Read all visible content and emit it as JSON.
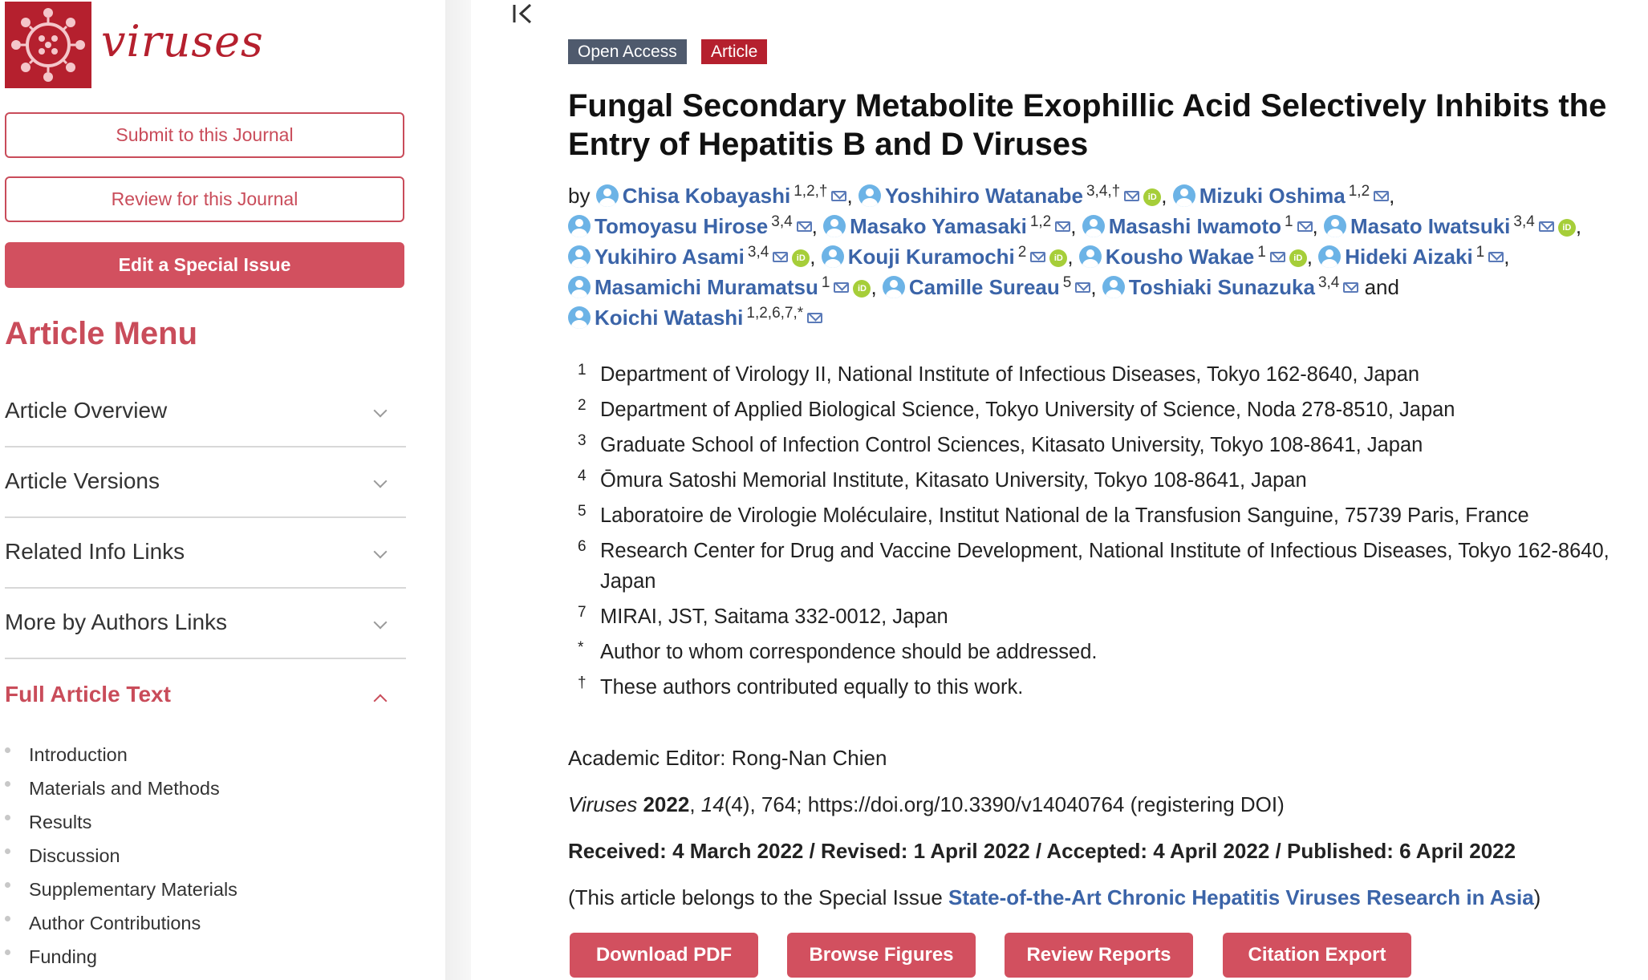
{
  "journal": {
    "name": "viruses",
    "submit_label": "Submit to this Journal",
    "review_label": "Review for this Journal",
    "special_issue_label": "Edit a Special Issue",
    "brand_color": "#b5202e"
  },
  "menu": {
    "title": "Article Menu",
    "items": [
      {
        "label": "Article Overview"
      },
      {
        "label": "Article Versions"
      },
      {
        "label": "Related Info Links"
      },
      {
        "label": "More by Authors Links"
      },
      {
        "label": "Full Article Text"
      }
    ],
    "toc": [
      "Introduction",
      "Materials and Methods",
      "Results",
      "Discussion",
      "Supplementary Materials",
      "Author Contributions",
      "Funding"
    ]
  },
  "article": {
    "badges": {
      "open_access": "Open Access",
      "type": "Article"
    },
    "title": "Fungal Secondary Metabolite Exophillic Acid Selectively Inhibits the Entry of Hepatitis B and D Viruses",
    "by": "by",
    "and": "and",
    "authors": [
      {
        "name": "Chisa Kobayashi",
        "aff": "1,2,†",
        "orcid": false
      },
      {
        "name": "Yoshihiro Watanabe",
        "aff": "3,4,†",
        "orcid": true
      },
      {
        "name": "Mizuki Oshima",
        "aff": "1,2",
        "orcid": false
      },
      {
        "name": "Tomoyasu Hirose",
        "aff": "3,4",
        "orcid": false
      },
      {
        "name": "Masako Yamasaki",
        "aff": "1,2",
        "orcid": false
      },
      {
        "name": "Masashi Iwamoto",
        "aff": "1",
        "orcid": false
      },
      {
        "name": "Masato Iwatsuki",
        "aff": "3,4",
        "orcid": true
      },
      {
        "name": "Yukihiro Asami",
        "aff": "3,4",
        "orcid": true
      },
      {
        "name": "Kouji Kuramochi",
        "aff": "2",
        "orcid": true
      },
      {
        "name": "Kousho Wakae",
        "aff": "1",
        "orcid": true
      },
      {
        "name": "Hideki Aizaki",
        "aff": "1",
        "orcid": false
      },
      {
        "name": "Masamichi Muramatsu",
        "aff": "1",
        "orcid": true
      },
      {
        "name": "Camille Sureau",
        "aff": "5",
        "orcid": false
      },
      {
        "name": "Toshiaki Sunazuka",
        "aff": "3,4",
        "orcid": false
      },
      {
        "name": "Koichi Watashi",
        "aff": "1,2,6,7,*",
        "orcid": false
      }
    ],
    "affiliations": [
      {
        "mark": "1",
        "text": "Department of Virology II, National Institute of Infectious Diseases, Tokyo 162-8640, Japan"
      },
      {
        "mark": "2",
        "text": "Department of Applied Biological Science, Tokyo University of Science, Noda 278-8510, Japan"
      },
      {
        "mark": "3",
        "text": "Graduate School of Infection Control Sciences, Kitasato University, Tokyo 108-8641, Japan"
      },
      {
        "mark": "4",
        "text": "Ōmura Satoshi Memorial Institute, Kitasato University, Tokyo 108-8641, Japan"
      },
      {
        "mark": "5",
        "text": "Laboratoire de Virologie Moléculaire, Institut National de la Transfusion Sanguine, 75739 Paris, France"
      },
      {
        "mark": "6",
        "text": "Research Center for Drug and Vaccine Development, National Institute of Infectious Diseases, Tokyo 162-8640, Japan"
      },
      {
        "mark": "7",
        "text": "MIRAI, JST, Saitama 332-0012, Japan"
      },
      {
        "mark": "*",
        "text": "Author to whom correspondence should be addressed."
      },
      {
        "mark": "†",
        "text": "These authors contributed equally to this work."
      }
    ],
    "academic_editor": "Academic Editor: Rong-Nan Chien",
    "citation": {
      "journal": "Viruses",
      "year": "2022",
      "volume": "14",
      "rest": "(4), 764; https://doi.org/10.3390/v14040764 (registering DOI)"
    },
    "dates": "Received: 4 March 2022 / Revised: 1 April 2022 / Accepted: 4 April 2022 / Published: 6 April 2022",
    "special_issue": {
      "prefix": "(This article belongs to the Special Issue ",
      "link": "State-of-the-Art Chronic Hepatitis Viruses Research in Asia",
      "suffix": ")"
    },
    "actions": [
      "Download PDF",
      "Browse Figures",
      "Review Reports",
      "Citation Export"
    ]
  }
}
